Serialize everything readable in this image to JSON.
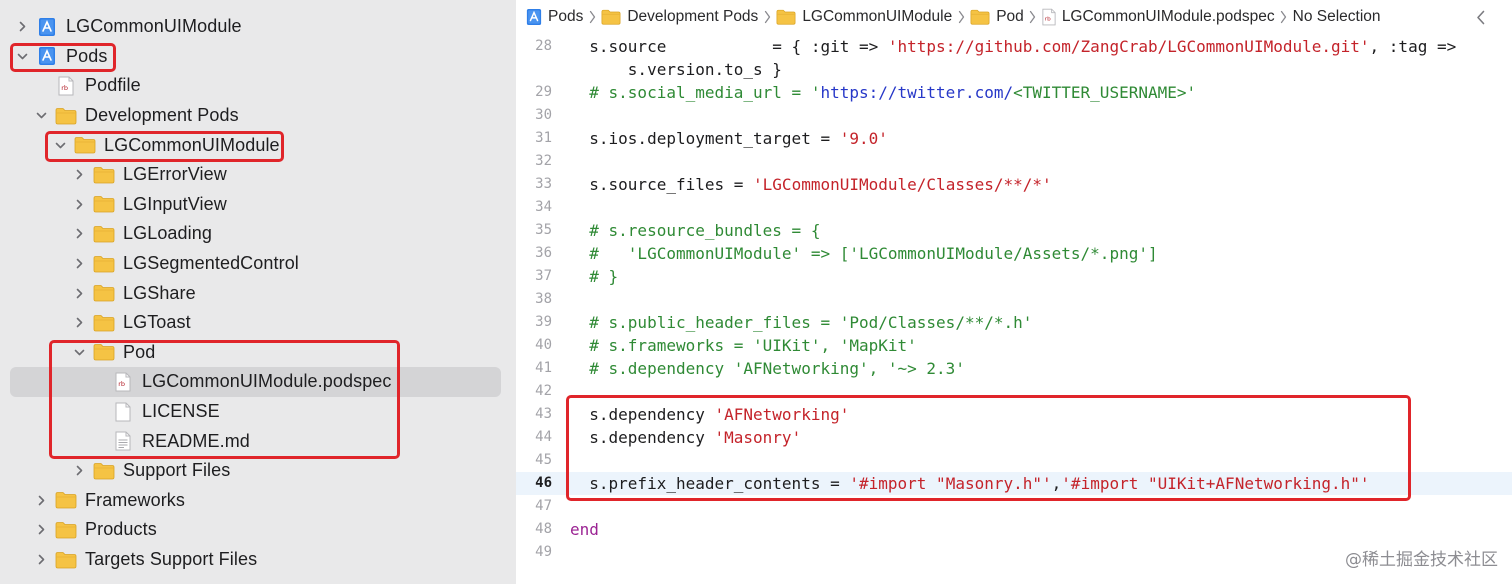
{
  "sidebar": {
    "items": [
      {
        "label": "LGCommonUIModule",
        "icon": "project-icon",
        "disclosure": "collapsed"
      },
      {
        "label": "Pods",
        "icon": "project-icon",
        "disclosure": "expanded"
      },
      {
        "label": "Podfile",
        "icon": "ruby-file-icon",
        "disclosure": "none"
      },
      {
        "label": "Development Pods",
        "icon": "folder-icon",
        "disclosure": "expanded"
      },
      {
        "label": "LGCommonUIModule",
        "icon": "folder-icon",
        "disclosure": "expanded"
      },
      {
        "label": "LGErrorView",
        "icon": "folder-icon",
        "disclosure": "collapsed"
      },
      {
        "label": "LGInputView",
        "icon": "folder-icon",
        "disclosure": "collapsed"
      },
      {
        "label": "LGLoading",
        "icon": "folder-icon",
        "disclosure": "collapsed"
      },
      {
        "label": "LGSegmentedControl",
        "icon": "folder-icon",
        "disclosure": "collapsed"
      },
      {
        "label": "LGShare",
        "icon": "folder-icon",
        "disclosure": "collapsed"
      },
      {
        "label": "LGToast",
        "icon": "folder-icon",
        "disclosure": "collapsed"
      },
      {
        "label": "Pod",
        "icon": "folder-icon",
        "disclosure": "expanded"
      },
      {
        "label": "LGCommonUIModule.podspec",
        "icon": "ruby-file-icon",
        "disclosure": "none",
        "selected": true
      },
      {
        "label": "LICENSE",
        "icon": "text-file-icon",
        "disclosure": "none"
      },
      {
        "label": "README.md",
        "icon": "markdown-file-icon",
        "disclosure": "none"
      },
      {
        "label": "Support Files",
        "icon": "folder-icon",
        "disclosure": "collapsed"
      },
      {
        "label": "Frameworks",
        "icon": "folder-icon",
        "disclosure": "collapsed"
      },
      {
        "label": "Products",
        "icon": "folder-icon",
        "disclosure": "collapsed"
      },
      {
        "label": "Targets Support Files",
        "icon": "folder-icon",
        "disclosure": "collapsed"
      }
    ]
  },
  "jumpbar": {
    "crumbs": [
      {
        "label": "Pods",
        "icon": "project-icon"
      },
      {
        "label": "Development Pods",
        "icon": "folder-icon"
      },
      {
        "label": "LGCommonUIModule",
        "icon": "folder-icon"
      },
      {
        "label": "Pod",
        "icon": "folder-icon"
      },
      {
        "label": "LGCommonUIModule.podspec",
        "icon": "ruby-file-icon"
      },
      {
        "label": "No Selection",
        "icon": ""
      }
    ],
    "back_icon": "chevron-left-icon"
  },
  "editor": {
    "current_line": "46",
    "lines": [
      {
        "num": "28",
        "tokens": [
          [
            "plain",
            "  s.source           = { :git => "
          ],
          [
            "string",
            "'https://github.com/ZangCrab/LGCommonUIModule.git'"
          ],
          [
            "plain",
            ", :tag =>"
          ]
        ]
      },
      {
        "num": "",
        "tokens": [
          [
            "plain",
            "      s.version.to_s }"
          ]
        ]
      },
      {
        "num": "29",
        "tokens": [
          [
            "comment",
            "  # s.social_media_url = '"
          ],
          [
            "url",
            "https://twitter.com/"
          ],
          [
            "comment",
            "<TWITTER_USERNAME>'"
          ]
        ]
      },
      {
        "num": "30",
        "tokens": []
      },
      {
        "num": "31",
        "tokens": [
          [
            "plain",
            "  s.ios.deployment_target = "
          ],
          [
            "string",
            "'9.0'"
          ]
        ]
      },
      {
        "num": "32",
        "tokens": []
      },
      {
        "num": "33",
        "tokens": [
          [
            "plain",
            "  s.source_files = "
          ],
          [
            "string",
            "'LGCommonUIModule/Classes/**/*'"
          ]
        ]
      },
      {
        "num": "34",
        "tokens": []
      },
      {
        "num": "35",
        "tokens": [
          [
            "comment",
            "  # s.resource_bundles = {"
          ]
        ]
      },
      {
        "num": "36",
        "tokens": [
          [
            "comment",
            "  #   'LGCommonUIModule' => ['LGCommonUIModule/Assets/*.png']"
          ]
        ]
      },
      {
        "num": "37",
        "tokens": [
          [
            "comment",
            "  # }"
          ]
        ]
      },
      {
        "num": "38",
        "tokens": []
      },
      {
        "num": "39",
        "tokens": [
          [
            "comment",
            "  # s.public_header_files = 'Pod/Classes/**/*.h'"
          ]
        ]
      },
      {
        "num": "40",
        "tokens": [
          [
            "comment",
            "  # s.frameworks = 'UIKit', 'MapKit'"
          ]
        ]
      },
      {
        "num": "41",
        "tokens": [
          [
            "comment",
            "  # s.dependency 'AFNetworking', '~> 2.3'"
          ]
        ]
      },
      {
        "num": "42",
        "tokens": []
      },
      {
        "num": "43",
        "tokens": [
          [
            "plain",
            "  s.dependency "
          ],
          [
            "string",
            "'AFNetworking'"
          ]
        ]
      },
      {
        "num": "44",
        "tokens": [
          [
            "plain",
            "  s.dependency "
          ],
          [
            "string",
            "'Masonry'"
          ]
        ]
      },
      {
        "num": "45",
        "tokens": []
      },
      {
        "num": "46",
        "tokens": [
          [
            "plain",
            "  s.prefix_header_contents = "
          ],
          [
            "string",
            "'#import \"Masonry.h\"'"
          ],
          [
            "plain",
            ","
          ],
          [
            "string",
            "'#import \"UIKit+AFNetworking.h\"'"
          ]
        ]
      },
      {
        "num": "47",
        "tokens": []
      },
      {
        "num": "48",
        "tokens": [
          [
            "keyword",
            "end"
          ]
        ]
      },
      {
        "num": "49",
        "tokens": []
      }
    ]
  },
  "watermark": "@稀土掘金技术社区",
  "colors": {
    "highlight_box": "#e0252a",
    "folder": "#f5c344",
    "selection": "#d4d4d6",
    "current_line": "#ecf4fc",
    "comment": "#2f8a35",
    "string": "#c4232a",
    "url": "#2738c8",
    "keyword": "#9b2393"
  }
}
